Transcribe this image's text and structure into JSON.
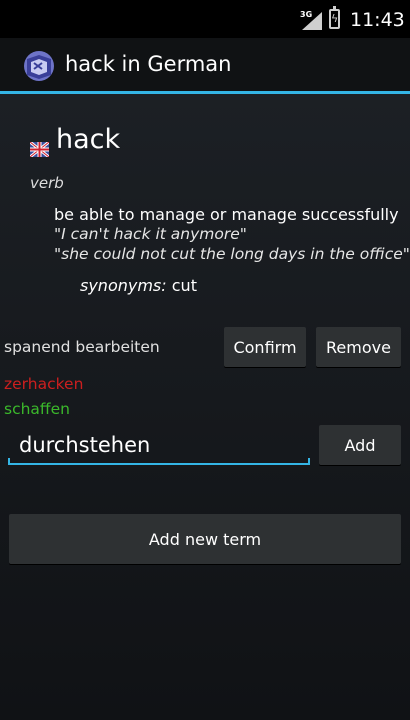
{
  "status_bar": {
    "network": "3G",
    "time": "11:43"
  },
  "action_bar": {
    "title": "hack in German",
    "app_icon": "dictionary-app-icon"
  },
  "entry": {
    "flag_icon": "uk-flag-icon",
    "headword": "hack",
    "part_of_speech": "verb",
    "definition": "be able to manage or manage successfully",
    "examples": [
      "\"I can't hack it anymore\"",
      "\"she could not cut the long days in the office\""
    ],
    "synonyms_label": "synonyms:",
    "synonyms_value": "cut"
  },
  "pending_translation": {
    "text": "spanend bearbeiten",
    "confirm_label": "Confirm",
    "remove_label": "Remove"
  },
  "translations": [
    {
      "text": "zerhacken",
      "color": "#cc1f1f"
    },
    {
      "text": "schaffen",
      "color": "#3bb82b"
    }
  ],
  "add_form": {
    "input_value": "durchstehen",
    "add_label": "Add",
    "new_term_label": "Add new term"
  },
  "colors": {
    "accent": "#34b5e5",
    "background": "#15181c",
    "button": "#2e3133"
  }
}
